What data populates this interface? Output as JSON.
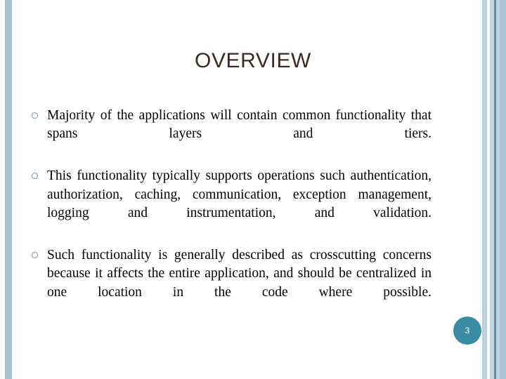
{
  "slide": {
    "title": "OVERVIEW",
    "title_color": "#3d2b23",
    "background_color": "#ffffff",
    "page_number": "3",
    "badge_color": "#3b8ba5",
    "bullet_color": "#6e93a8",
    "accent_stripe_color": "#a8c2d2",
    "bullets": [
      "Majority of the applications will contain common functionality that spans layers and tiers.",
      "This functionality typically supports operations such authentication, authorization, caching, communication, exception management, logging and instrumentation, and validation.",
      "Such functionality is generally described as crosscutting concerns because it affects the entire application, and should be centralized in one location in the code where possible."
    ]
  }
}
